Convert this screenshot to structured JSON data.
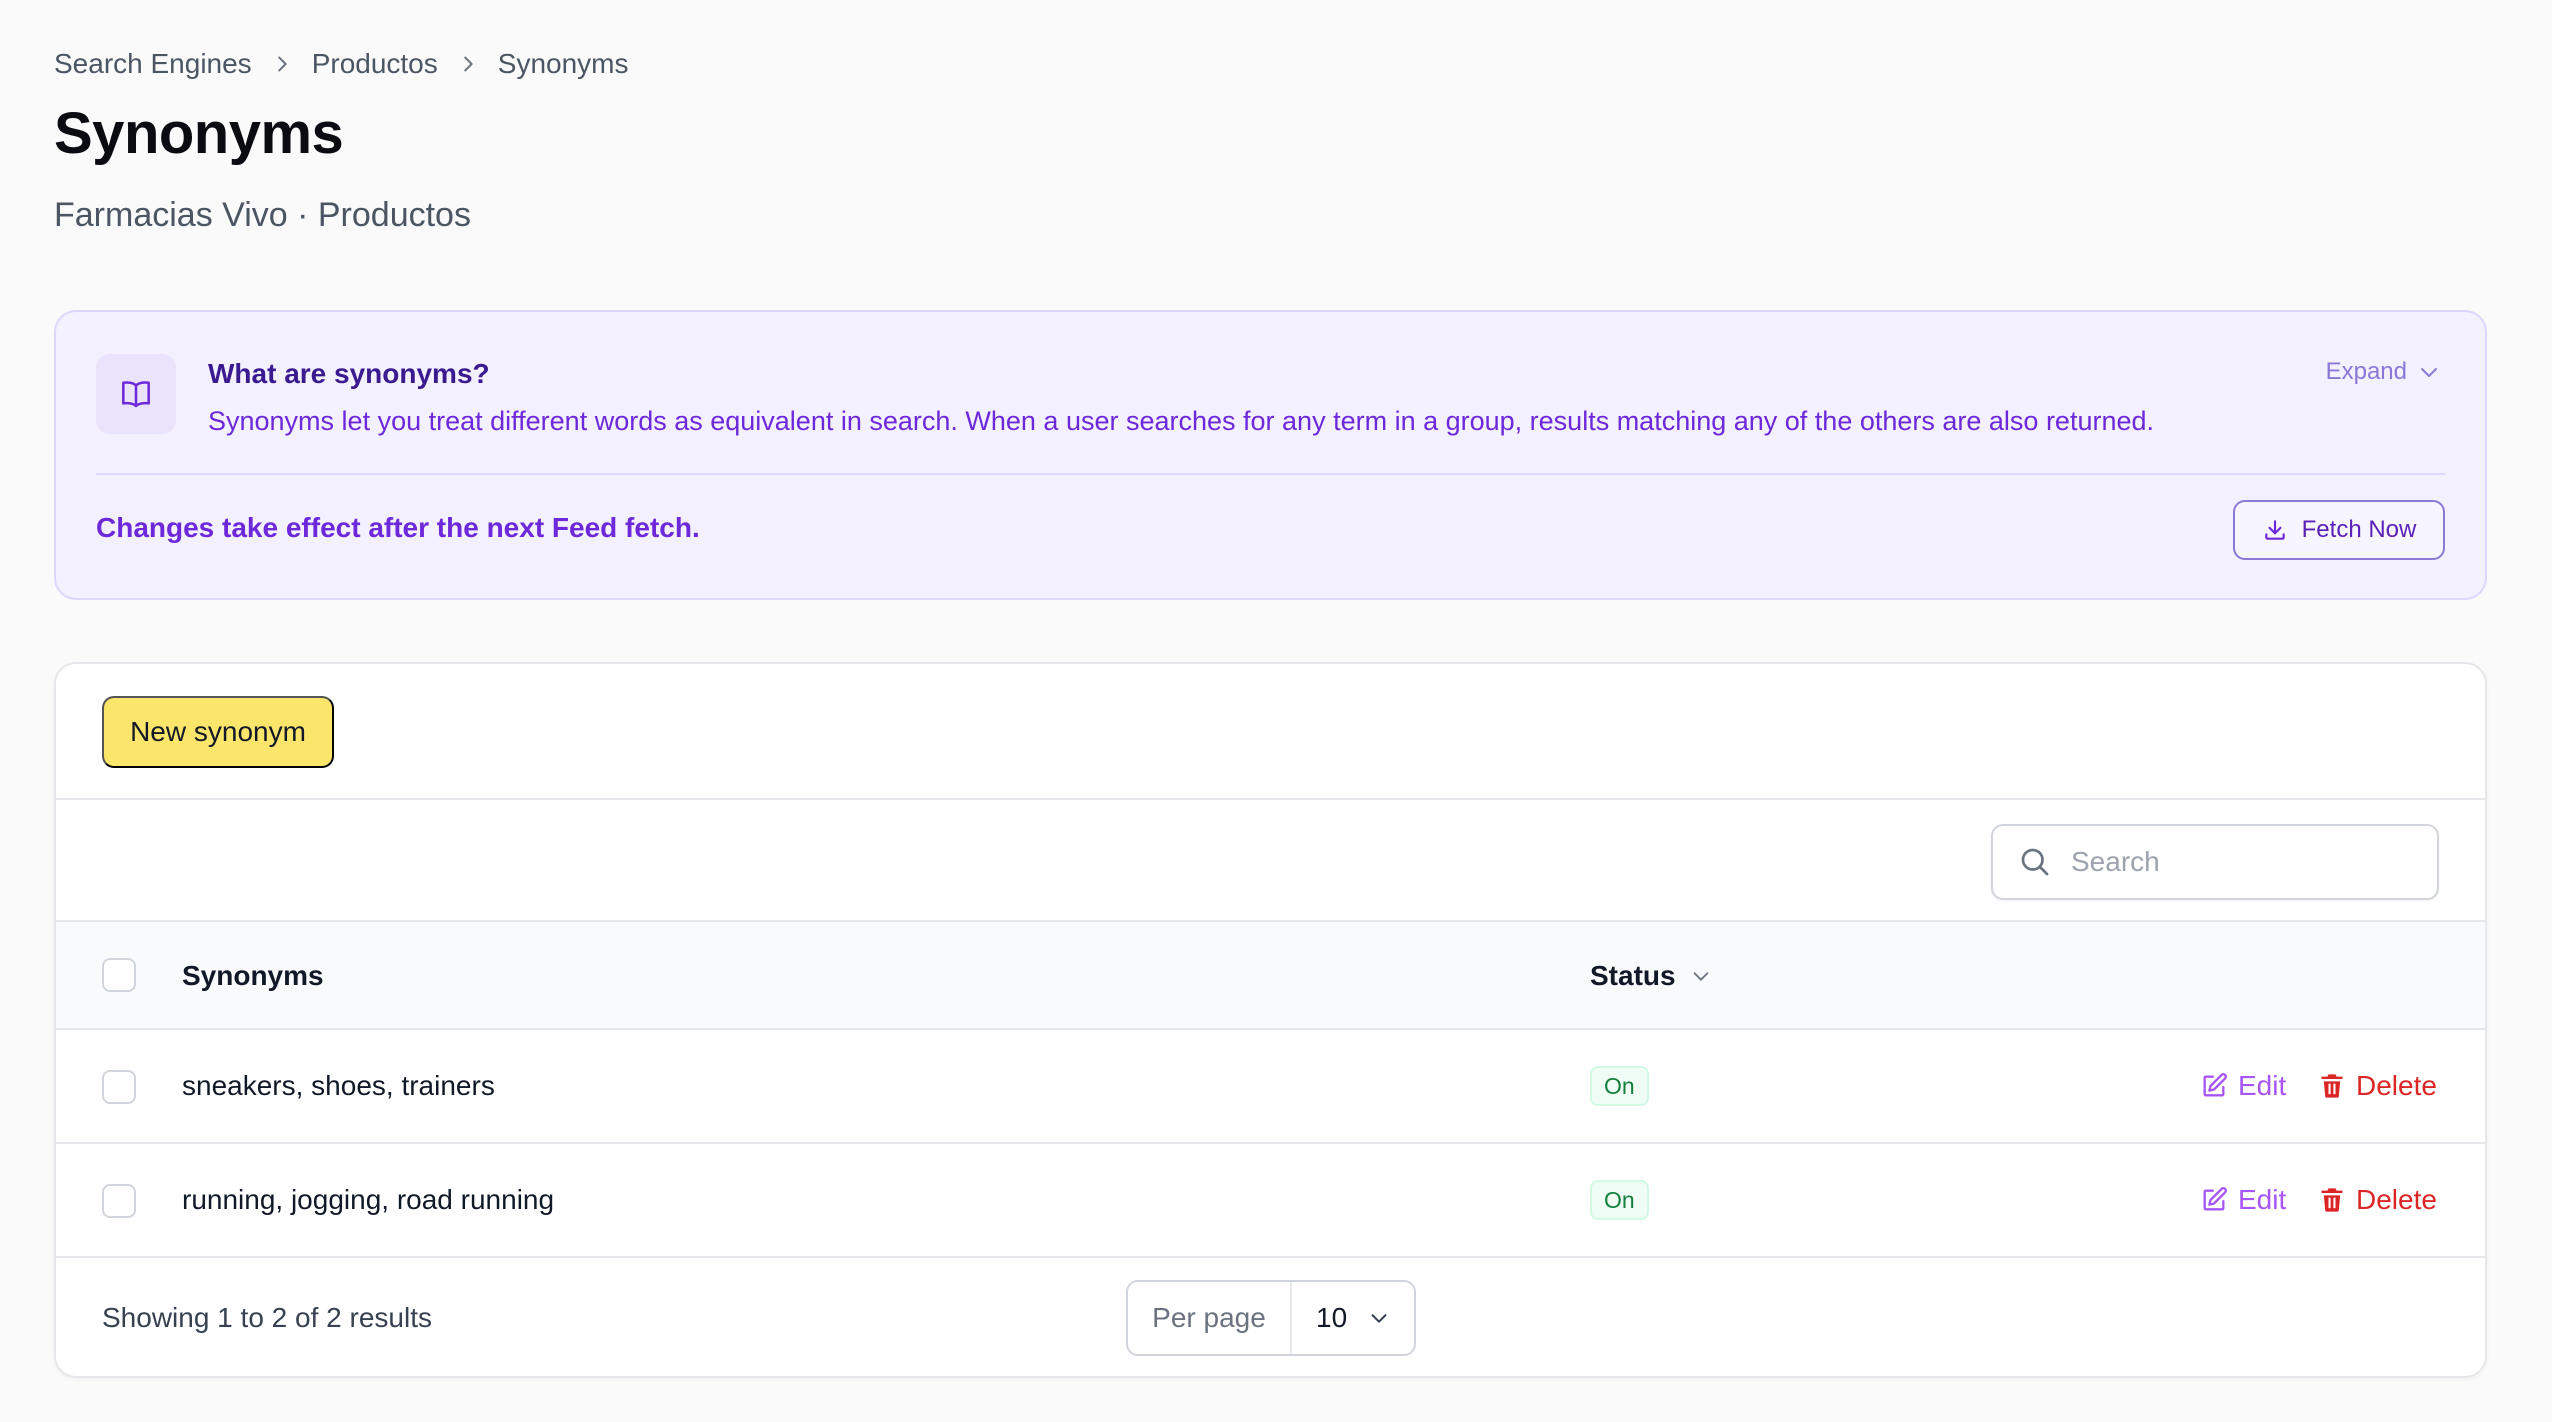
{
  "breadcrumb": [
    "Search Engines",
    "Productos",
    "Synonyms"
  ],
  "page": {
    "title": "Synonyms",
    "subtitle": "Farmacias Vivo · Productos"
  },
  "info": {
    "title": "What are synonyms?",
    "description": "Synonyms let you treat different words as equivalent in search. When a user searches for any term in a group, results matching any of the others are also returned.",
    "expand_label": "Expand",
    "note": "Changes take effect after the next Feed fetch.",
    "fetch_label": "Fetch Now",
    "icon": "book-open-icon"
  },
  "toolbar": {
    "new_label": "New synonym",
    "search_placeholder": "Search",
    "search_value": ""
  },
  "table": {
    "columns": {
      "synonyms": "Synonyms",
      "status": "Status"
    },
    "rows": [
      {
        "synonyms": "sneakers, shoes, trainers",
        "status": "On",
        "edit": "Edit",
        "delete": "Delete"
      },
      {
        "synonyms": "running, jogging, road running",
        "status": "On",
        "edit": "Edit",
        "delete": "Delete"
      }
    ]
  },
  "footer": {
    "summary": "Showing 1 to 2 of 2 results",
    "per_page_label": "Per page",
    "per_page_value": "10"
  },
  "colors": {
    "accent_purple": "#6d28d9",
    "primary_button": "#fbe56a",
    "danger": "#dc2626",
    "status_on": "#15803d"
  }
}
